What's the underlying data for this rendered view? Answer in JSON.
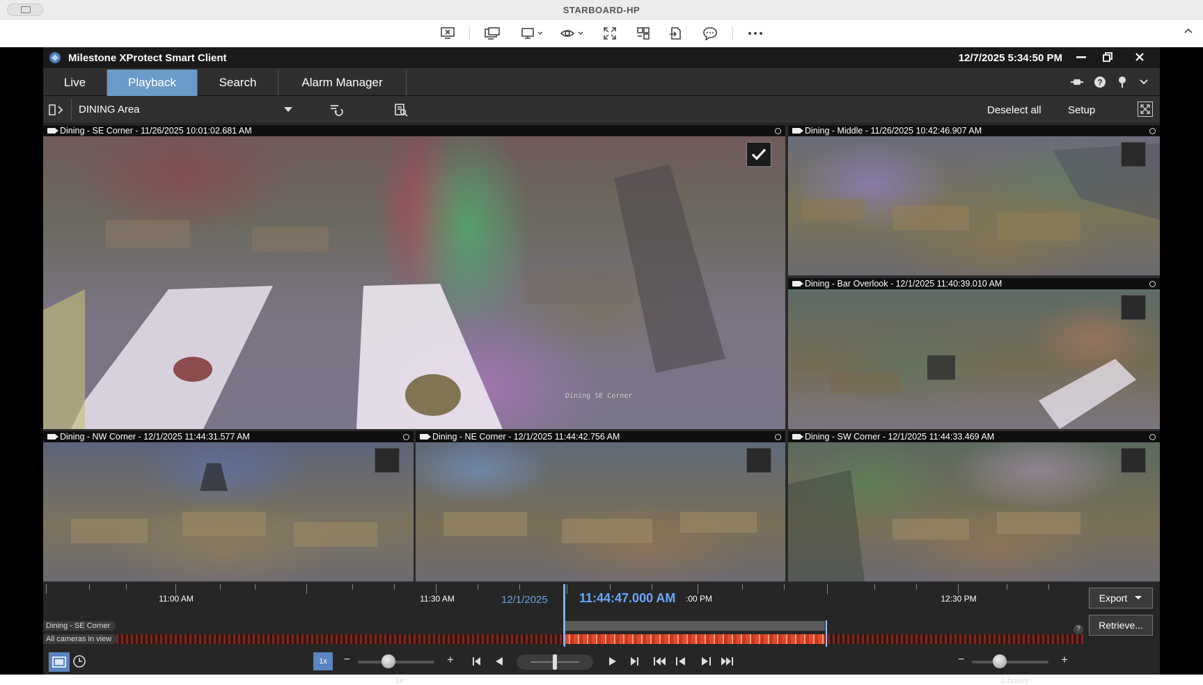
{
  "remote_desktop": {
    "title": "STARBOARD-HP"
  },
  "app": {
    "name": "Milestone XProtect Smart Client",
    "datetime": "12/7/2025 5:34:50 PM"
  },
  "tabs": [
    {
      "label": "Live",
      "active": false
    },
    {
      "label": "Playback",
      "active": true
    },
    {
      "label": "Search",
      "active": false
    },
    {
      "label": "Alarm Manager",
      "active": false
    }
  ],
  "viewbar": {
    "view_name": "DINING Area",
    "deselect_label": "Deselect all",
    "setup_label": "Setup"
  },
  "cameras": [
    {
      "title": "Dining - SE Corner - 11/26/2025 10:01:02.681 AM",
      "selected": true,
      "overlay": "Dining SE Corner"
    },
    {
      "title": "Dining - Middle - 11/26/2025 10:42:46.907 AM",
      "selected": false,
      "overlay": ""
    },
    {
      "title": "Dining - Bar Overlook - 12/1/2025 11:40:39.010 AM",
      "selected": false,
      "overlay": ""
    },
    {
      "title": "Dining - NW Corner - 12/1/2025 11:44:31.577 AM",
      "selected": false,
      "overlay": ""
    },
    {
      "title": "Dining - NE Corner - 12/1/2025 11:44:42.756 AM",
      "selected": false,
      "overlay": ""
    },
    {
      "title": "Dining - SW Corner - 12/1/2025 11:44:33.469 AM",
      "selected": false,
      "overlay": ""
    }
  ],
  "timeline": {
    "labels": [
      "11:00 AM",
      "11:30 AM",
      ":00 PM",
      "12:30 PM"
    ],
    "date": "12/1/2025",
    "current_time": "11:44:47.000 AM",
    "track_primary": "Dining - SE Corner",
    "track_all": "All cameras in view",
    "export_label": "Export",
    "retrieve_label": "Retrieve...",
    "help": "?"
  },
  "controls": {
    "speed_badge": "1x",
    "speed_label": "1x",
    "span_label": "2 hours"
  },
  "colors": {
    "accent": "#6a9ac8",
    "playhead": "#7fb0ff",
    "recording": "#c0392b"
  }
}
